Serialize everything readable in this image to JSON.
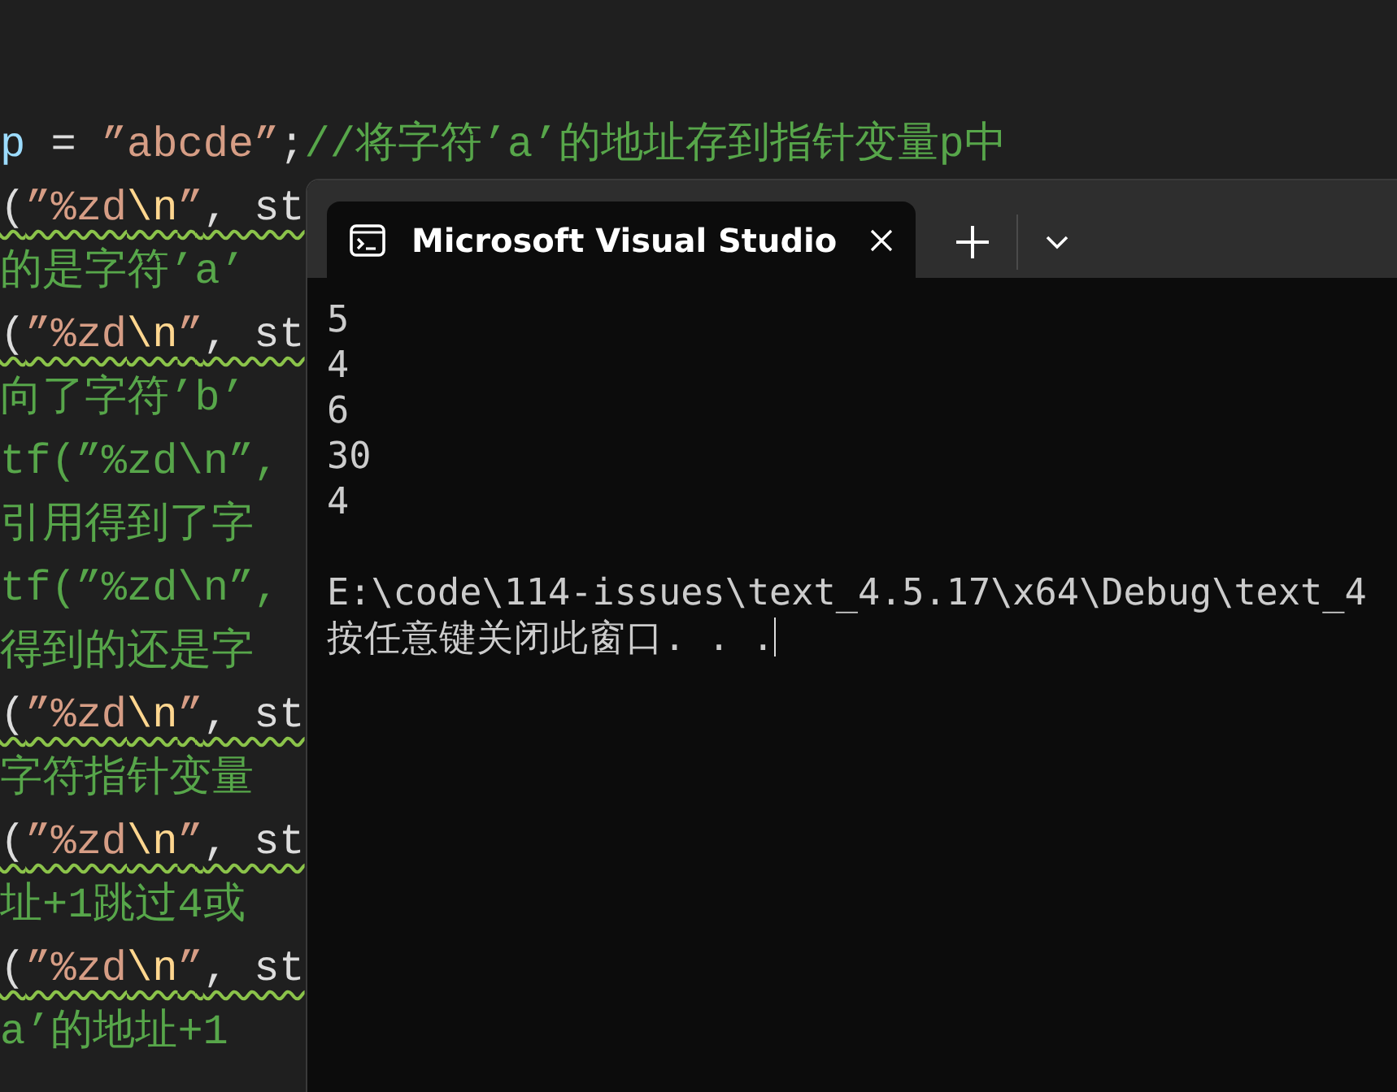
{
  "editor": {
    "lines": [
      {
        "warning": false,
        "tokens": [
          {
            "text": "p",
            "kind": "ident"
          },
          {
            "text": " = ",
            "kind": "plain"
          },
          {
            "text": "”abcde”",
            "kind": "string"
          },
          {
            "text": ";",
            "kind": "plain"
          },
          {
            "text": "//将字符’a’的地址存到指针变量p中",
            "kind": "comment"
          }
        ]
      },
      {
        "warning": true,
        "tokens": [
          {
            "text": "(",
            "kind": "plain"
          },
          {
            "text": "”%zd",
            "kind": "string"
          },
          {
            "text": "\\n",
            "kind": "escape"
          },
          {
            "text": "”",
            "kind": "string"
          },
          {
            "text": ", st",
            "kind": "plain"
          }
        ]
      },
      {
        "warning": false,
        "tokens": [
          {
            "text": "的是字符’a’",
            "kind": "comment"
          }
        ]
      },
      {
        "warning": true,
        "tokens": [
          {
            "text": "(",
            "kind": "plain"
          },
          {
            "text": "”%zd",
            "kind": "string"
          },
          {
            "text": "\\n",
            "kind": "escape"
          },
          {
            "text": "”",
            "kind": "string"
          },
          {
            "text": ", st",
            "kind": "plain"
          }
        ]
      },
      {
        "warning": false,
        "tokens": [
          {
            "text": "向了字符’b’",
            "kind": "comment"
          }
        ]
      },
      {
        "warning": false,
        "tokens": [
          {
            "text": "tf(”%zd\\n”,",
            "kind": "comment"
          }
        ]
      },
      {
        "warning": false,
        "tokens": [
          {
            "text": "引用得到了字",
            "kind": "comment"
          }
        ]
      },
      {
        "warning": false,
        "tokens": [
          {
            "text": "tf(”%zd\\n”,",
            "kind": "comment"
          }
        ]
      },
      {
        "warning": false,
        "tokens": [
          {
            "text": "得到的还是字",
            "kind": "comment"
          }
        ]
      },
      {
        "warning": true,
        "tokens": [
          {
            "text": "(",
            "kind": "plain"
          },
          {
            "text": "”%zd",
            "kind": "string"
          },
          {
            "text": "\\n",
            "kind": "escape"
          },
          {
            "text": "”",
            "kind": "string"
          },
          {
            "text": ", st",
            "kind": "plain"
          }
        ]
      },
      {
        "warning": false,
        "tokens": [
          {
            "text": "字符指针变量",
            "kind": "comment"
          }
        ]
      },
      {
        "warning": true,
        "tokens": [
          {
            "text": "(",
            "kind": "plain"
          },
          {
            "text": "”%zd",
            "kind": "string"
          },
          {
            "text": "\\n",
            "kind": "escape"
          },
          {
            "text": "”",
            "kind": "string"
          },
          {
            "text": ", st",
            "kind": "plain"
          }
        ]
      },
      {
        "warning": false,
        "tokens": [
          {
            "text": "址+1跳过4或",
            "kind": "comment"
          }
        ]
      },
      {
        "warning": true,
        "tokens": [
          {
            "text": "(",
            "kind": "plain"
          },
          {
            "text": "”%zd",
            "kind": "string"
          },
          {
            "text": "\\n",
            "kind": "escape"
          },
          {
            "text": "”",
            "kind": "string"
          },
          {
            "text": ", st",
            "kind": "plain"
          }
        ]
      },
      {
        "warning": false,
        "tokens": [
          {
            "text": "a’的地址+1",
            "kind": "comment"
          }
        ]
      }
    ]
  },
  "terminal": {
    "tabs": [
      {
        "title": "Microsoft Visual Studio",
        "selected": true
      }
    ],
    "output": [
      "5",
      "4",
      "6",
      "30",
      "4"
    ],
    "path": "E:\\code\\114-issues\\text_4.5.17\\x64\\Debug\\text_4",
    "prompt": "按任意键关闭此窗口. . ."
  }
}
